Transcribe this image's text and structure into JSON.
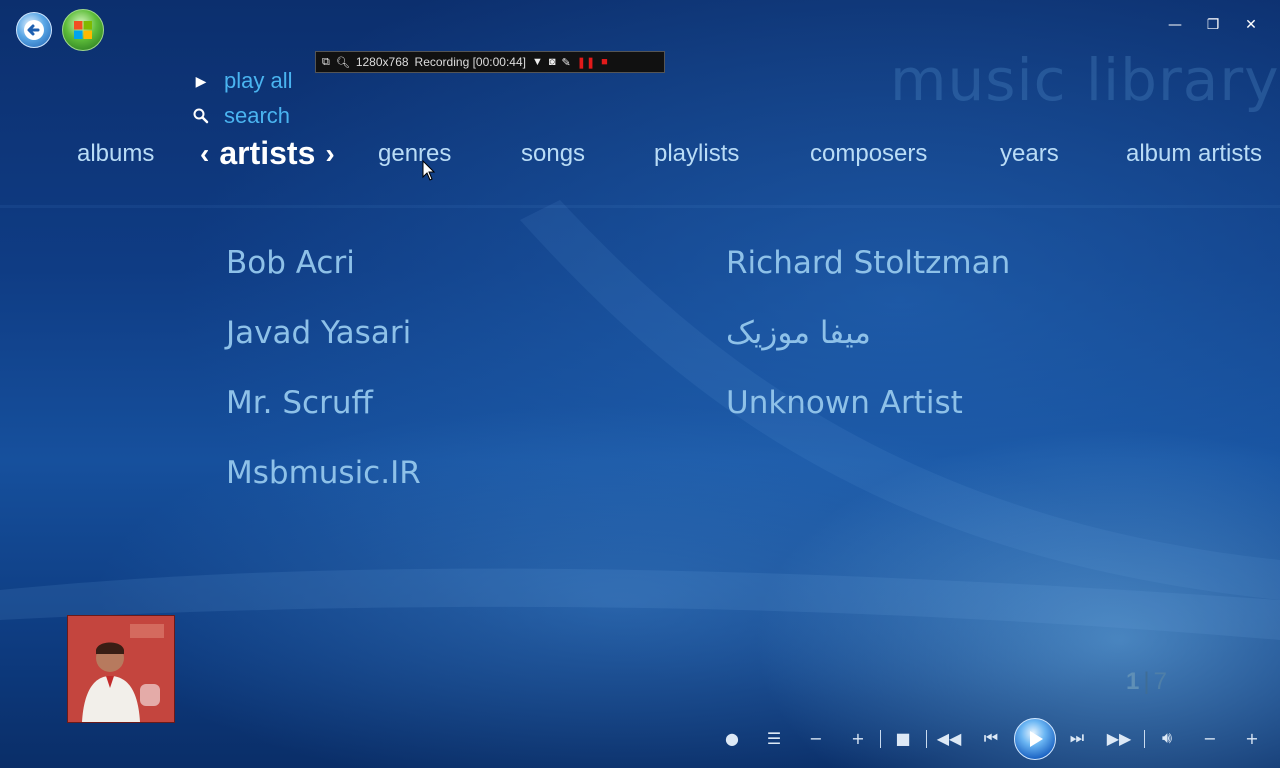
{
  "window": {
    "minimize_glyph": "—",
    "restore_glyph": "❐",
    "close_glyph": "✕"
  },
  "recorder_bar": {
    "resolution": "1280x768",
    "status": "Recording [00:00:44]"
  },
  "header": {
    "section_title": "music library"
  },
  "quick_links": {
    "play_all": "play all",
    "search": "search"
  },
  "pivot": {
    "items_before": [
      "albums"
    ],
    "active": "artists",
    "items_after": [
      "genres",
      "songs",
      "playlists",
      "composers",
      "years",
      "album artists"
    ]
  },
  "artists": {
    "column1": [
      "Bob Acri",
      "Javad Yasari",
      "Mr. Scruff",
      "Msbmusic.IR"
    ],
    "column2": [
      "Richard Stoltzman",
      "میفا موزیک",
      "Unknown Artist"
    ]
  },
  "pager": {
    "current": "1",
    "total": "7"
  },
  "now_playing": {
    "thumbnail_icon": "album-art-icon"
  },
  "colors": {
    "accent_link": "#4ab4f0",
    "artist_text": "#8ec1e8",
    "pivot_text": "#b9dcf6"
  }
}
